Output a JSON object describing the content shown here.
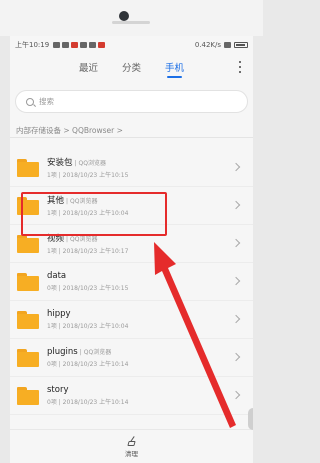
{
  "statusbar": {
    "time": "上午10:19",
    "speed": "0.42K/s"
  },
  "tabs": [
    {
      "label": "最近",
      "active": false
    },
    {
      "label": "分类",
      "active": false
    },
    {
      "label": "手机",
      "active": true
    }
  ],
  "search": {
    "placeholder": "搜索"
  },
  "breadcrumb": "内部存储设备 > QQBrowser >",
  "folders": [
    {
      "name": "安装包",
      "source": "QQ浏览器",
      "meta": "1项 | 2018/10/23 上午10:15"
    },
    {
      "name": "其他",
      "source": "QQ浏览器",
      "meta": "1项 | 2018/10/23 上午10:04"
    },
    {
      "name": "视频",
      "source": "QQ浏览器",
      "meta": "1项 | 2018/10/23 上午10:17"
    },
    {
      "name": "data",
      "source": "",
      "meta": "0项 | 2018/10/23 上午10:15"
    },
    {
      "name": "hippy",
      "source": "",
      "meta": "1项 | 2018/10/23 上午10:04"
    },
    {
      "name": "plugins",
      "source": "QQ浏览器",
      "meta": "0项 | 2018/10/23 上午10:14"
    },
    {
      "name": "story",
      "source": "",
      "meta": "0项 | 2018/10/23 上午10:14"
    }
  ],
  "bottom": {
    "label": "清理"
  },
  "colors": {
    "accent": "#1c6fe6",
    "folder": "#f7ae23",
    "annotation": "#e52b2b"
  },
  "annotation": {
    "highlighted_folder": "视频"
  }
}
